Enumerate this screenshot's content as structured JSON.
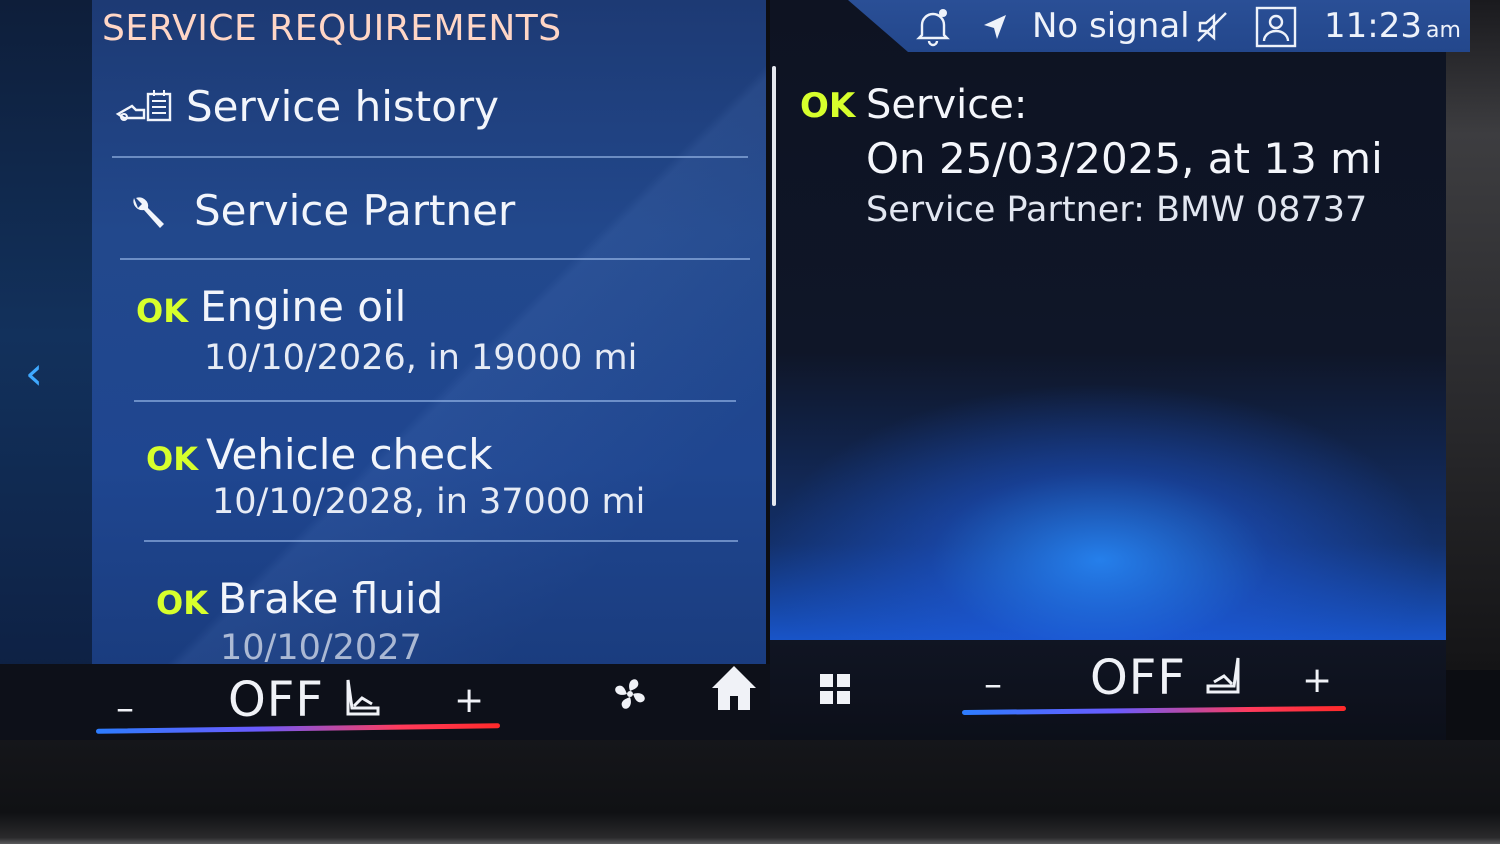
{
  "left_panel": {
    "title": "SERVICE REQUIREMENTS",
    "menu": [
      {
        "label": "Service history",
        "icon": "service-history-icon"
      },
      {
        "label": "Service Partner",
        "icon": "wrench-icon"
      }
    ],
    "items": [
      {
        "status": "OK",
        "title": "Engine oil",
        "detail": "10/10/2026, in 19000 mi"
      },
      {
        "status": "OK",
        "title": "Vehicle check",
        "detail": "10/10/2028, in 37000 mi"
      },
      {
        "status": "OK",
        "title": "Brake fluid",
        "detail": "10/10/2027"
      }
    ]
  },
  "status_bar": {
    "signal": "No signal",
    "time": "11:23",
    "ampm": "am",
    "icons": [
      "notification-bell-icon",
      "navigation-arrow-icon",
      "mute-icon",
      "profile-icon"
    ]
  },
  "detail": {
    "status": "OK",
    "title": "Service:",
    "line": "On 25/03/2025, at 13 mi",
    "partner": "Service Partner: BMW 08737"
  },
  "climate": {
    "left": {
      "minus": "–",
      "value": "OFF",
      "plus": "+"
    },
    "right": {
      "minus": "–",
      "value": "OFF",
      "plus": "+"
    },
    "center_icons": [
      "fan-icon",
      "home-icon",
      "apps-grid-icon"
    ]
  },
  "colors": {
    "ok": "#d7ff2c",
    "accent": "#3fa9ff",
    "title": "#ffd6c6",
    "panel": "#22488c"
  }
}
